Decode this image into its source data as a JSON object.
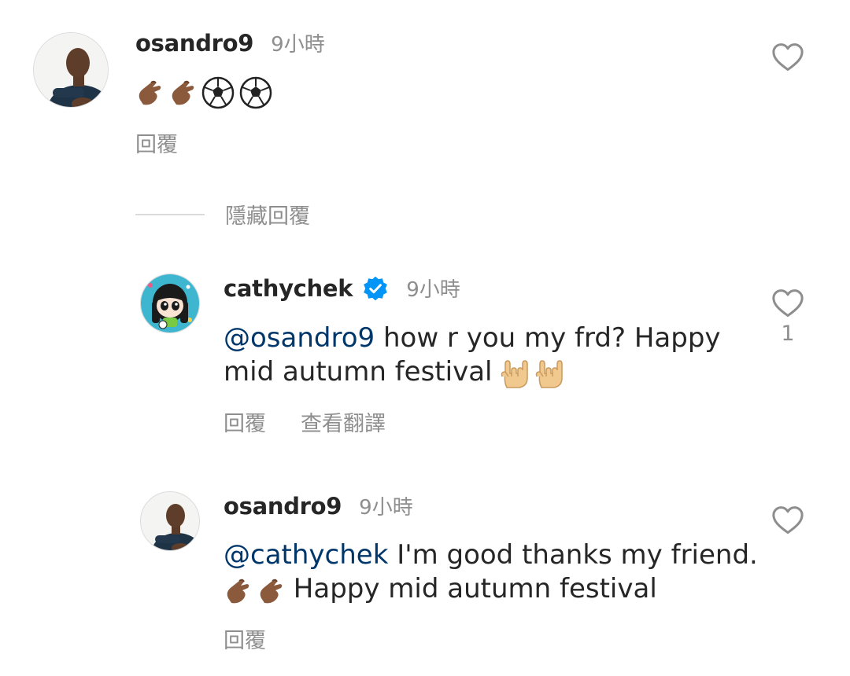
{
  "comments": [
    {
      "username": "osandro9",
      "time": "9小時",
      "emojis": [
        "call-me-hand-emoji",
        "call-me-hand-emoji",
        "soccer-ball-emoji",
        "soccer-ball-emoji"
      ],
      "reply_label": "回覆",
      "likes": ""
    }
  ],
  "hide_replies_label": "隱藏回覆",
  "replies": [
    {
      "username": "cathychek",
      "verified": true,
      "time": "9小時",
      "mention": "@osandro9",
      "text_line1": " how r you my frd? Happy",
      "text_line2": "mid autumn festival ",
      "emojis": [
        "love-you-gesture-emoji",
        "love-you-gesture-emoji"
      ],
      "reply_label": "回覆",
      "translate_label": "查看翻譯",
      "likes": "1"
    },
    {
      "username": "osandro9",
      "time": "9小時",
      "mention": "@cathychek",
      "text_line1": " I'm good thanks my friend.",
      "text_line2": " Happy mid autumn festival",
      "emojis": [
        "call-me-hand-emoji",
        "call-me-hand-emoji"
      ],
      "reply_label": "回覆",
      "likes": ""
    }
  ],
  "colors": {
    "mention": "#00376b",
    "secondary_text": "#8e8e8e",
    "verified_badge": "#0095f6"
  }
}
